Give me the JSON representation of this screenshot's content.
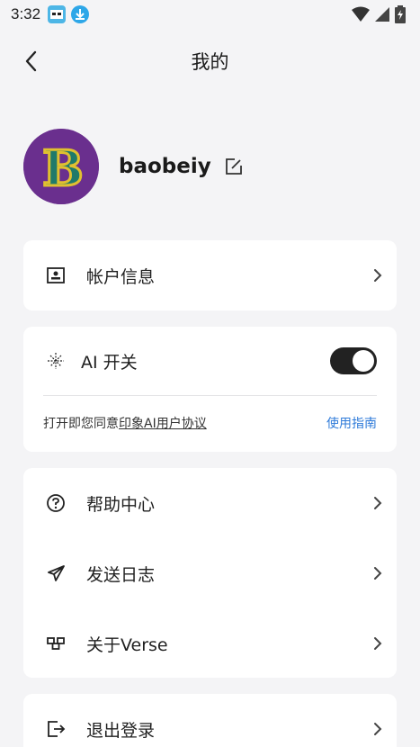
{
  "status_bar": {
    "time": "3:32"
  },
  "header": {
    "title": "我的"
  },
  "profile": {
    "username": "baobeiy",
    "avatar_letter": "B"
  },
  "account_card": {
    "account_info_label": "帐户信息"
  },
  "ai_card": {
    "label": "AI 开关",
    "toggle_on": true,
    "agreement_prefix": "打开即您同意",
    "agreement_link": "印象AI用户协议",
    "guide_link": "使用指南"
  },
  "menu_card": {
    "items": [
      {
        "label": "帮助中心",
        "icon": "help-circle-icon"
      },
      {
        "label": "发送日志",
        "icon": "send-icon"
      },
      {
        "label": "关于Verse",
        "icon": "verse-logo-icon"
      }
    ]
  },
  "logout_card": {
    "label": "退出登录"
  },
  "colors": {
    "background": "#f4f4f6",
    "card": "#ffffff",
    "accent_link": "#2f7bd9",
    "toggle_on": "#222222",
    "avatar_bg": "#6a2f8e"
  }
}
